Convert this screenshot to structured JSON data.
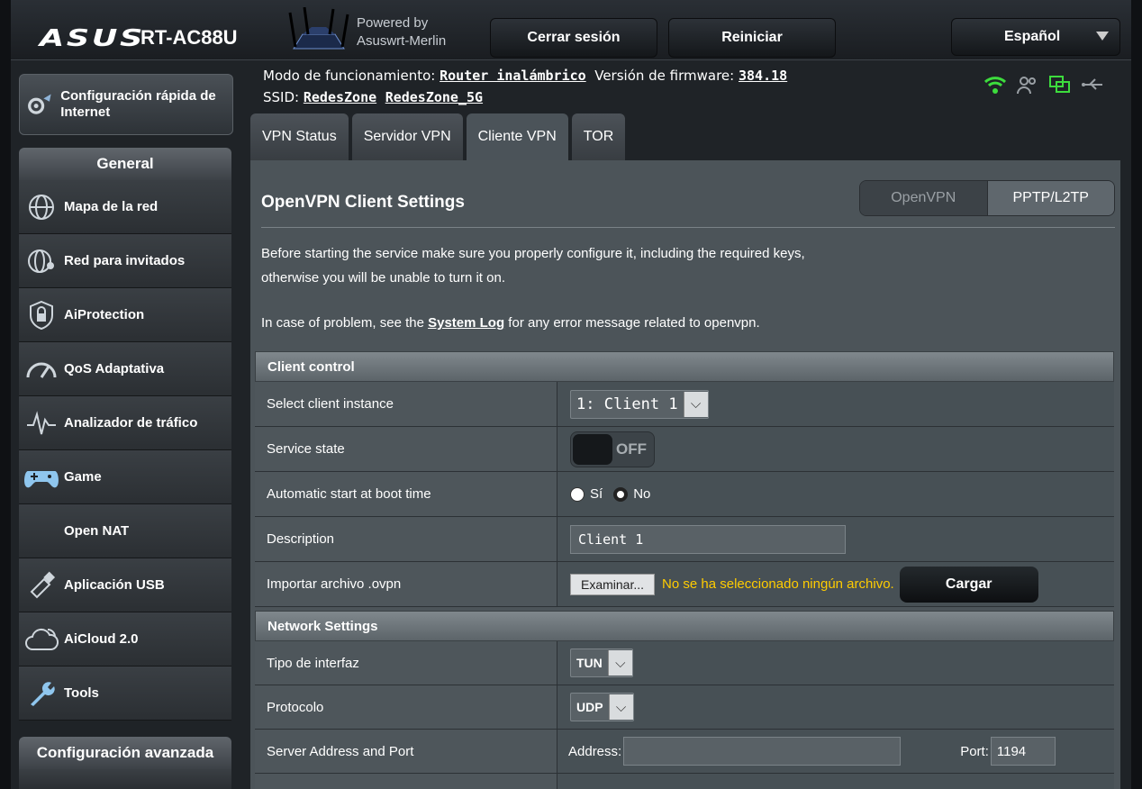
{
  "header": {
    "brand": "ASUS",
    "model": "RT-AC88U",
    "powered_line1": "Powered by",
    "powered_line2": "Asuswrt-Merlin",
    "logout_label": "Cerrar sesión",
    "reboot_label": "Reiniciar",
    "language": "Español"
  },
  "sidebar": {
    "quick_setup": "Configuración rápida de Internet",
    "general_heading": "General",
    "items": [
      {
        "label": "Mapa de la red",
        "icon": "network-map-icon"
      },
      {
        "label": "Red para invitados",
        "icon": "guest-network-icon"
      },
      {
        "label": "AiProtection",
        "icon": "shield-lock-icon"
      },
      {
        "label": "QoS Adaptativa",
        "icon": "speedometer-icon"
      },
      {
        "label": "Analizador de tráfico",
        "icon": "traffic-analyzer-icon"
      },
      {
        "label": "Game",
        "icon": "gamepad-icon"
      },
      {
        "label": "Open NAT",
        "icon": ""
      },
      {
        "label": "Aplicación USB",
        "icon": "usb-app-icon"
      },
      {
        "label": "AiCloud 2.0",
        "icon": "cloud-icon"
      },
      {
        "label": "Tools",
        "icon": "wrench-icon"
      }
    ],
    "advanced_heading": "Configuración avanzada"
  },
  "info": {
    "mode_label": "Modo de funcionamiento:",
    "mode_value": "Router inalámbrico",
    "fw_label": "Versión de firmware:",
    "fw_value": "384.18",
    "ssid_label": "SSID:",
    "ssid_1": "RedesZone",
    "ssid_2": "RedesZone_5G"
  },
  "tabs": [
    "VPN Status",
    "Servidor VPN",
    "Cliente VPN",
    "TOR"
  ],
  "main": {
    "title": "OpenVPN Client Settings",
    "seg_openvpn": "OpenVPN",
    "seg_pptp": "PPTP/L2TP",
    "desc_1": "Before starting the service make sure you properly configure it, including the required keys,",
    "desc_2": "otherwise you will be unable to turn it on.",
    "problem_pre": "In case of problem, see the ",
    "problem_link": "System Log",
    "problem_post": " for any error message related to openvpn."
  },
  "client_control": {
    "heading": "Client control",
    "instance_label": "Select client instance",
    "instance_value": "1: Client 1",
    "service_label": "Service state",
    "service_value": "OFF",
    "autostart_label": "Automatic start at boot time",
    "yes": "Sí",
    "no": "No",
    "description_label": "Description",
    "description_value": "Client 1",
    "import_label": "Importar archivo .ovpn",
    "browse": "Examinar...",
    "no_file": "No se ha seleccionado ningún archivo.",
    "upload": "Cargar"
  },
  "network": {
    "heading": "Network Settings",
    "iface_label": "Tipo de interfaz",
    "iface_value": "TUN",
    "proto_label": "Protocolo",
    "proto_value": "UDP",
    "server_label": "Server Address and Port",
    "address_label": "Address:",
    "address_value": "",
    "port_label": "Port:",
    "port_value": "1194"
  }
}
